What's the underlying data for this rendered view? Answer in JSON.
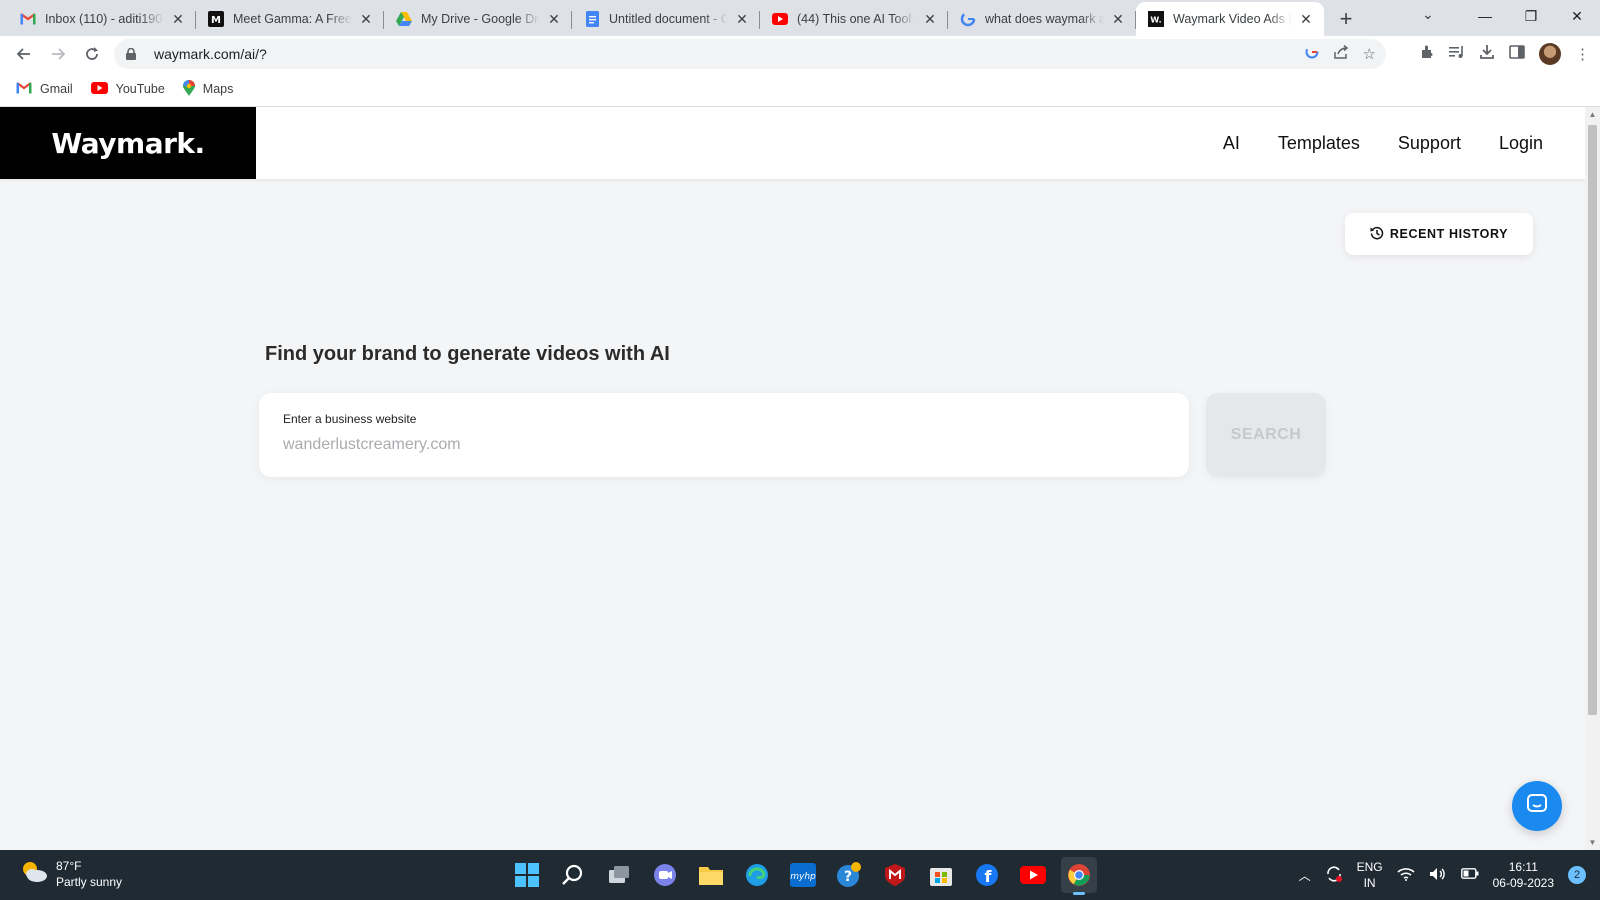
{
  "browser": {
    "tabs": [
      {
        "title": "Inbox (110) - aditi190",
        "icon": "gmail-icon"
      },
      {
        "title": "Meet Gamma: A Free",
        "icon": "medium-icon"
      },
      {
        "title": "My Drive - Google Dri",
        "icon": "google-drive-icon"
      },
      {
        "title": "Untitled document - G",
        "icon": "google-docs-icon"
      },
      {
        "title": "(44) This one AI Tool i",
        "icon": "youtube-icon"
      },
      {
        "title": "what does waymark a",
        "icon": "google-icon"
      },
      {
        "title": "Waymark Video Ads |",
        "icon": "waymark-icon",
        "active": true
      }
    ],
    "url": "waymark.com/ai/?",
    "bookmarks": [
      {
        "label": "Gmail",
        "icon": "gmail-icon"
      },
      {
        "label": "YouTube",
        "icon": "youtube-icon"
      },
      {
        "label": "Maps",
        "icon": "maps-icon"
      }
    ]
  },
  "site": {
    "logo": "Waymark.",
    "nav": [
      "AI",
      "Templates",
      "Support",
      "Login"
    ],
    "recent_history_label": "RECENT HISTORY",
    "heading": "Find your brand to generate videos with AI",
    "search": {
      "label": "Enter a business website",
      "placeholder": "wanderlustcreamery.com",
      "button_label": "SEARCH"
    }
  },
  "taskbar": {
    "weather": {
      "temp": "87°F",
      "condition": "Partly sunny"
    },
    "language": {
      "line1": "ENG",
      "line2": "IN"
    },
    "clock": {
      "time": "16:11",
      "date": "06-09-2023"
    },
    "notifications": "2"
  },
  "colors": {
    "accent_chat": "#1a8af0",
    "logo_bg": "#000000",
    "page_bg": "#f4f5f7",
    "taskbar_bg": "#1f2a33"
  }
}
